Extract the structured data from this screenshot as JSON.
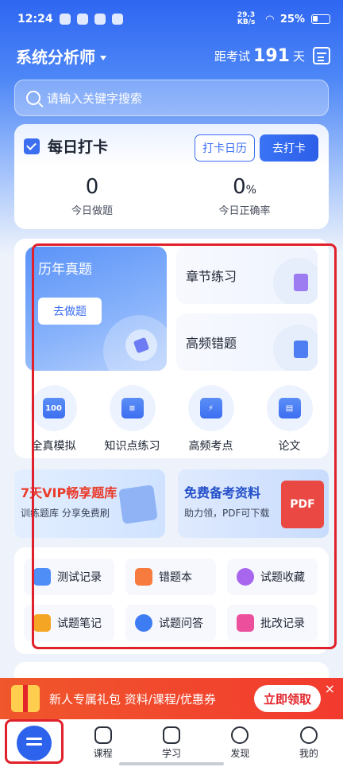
{
  "status": {
    "time": "12:24",
    "speed": "29.3 KB/s",
    "battery": "25%"
  },
  "header": {
    "title": "系统分析师",
    "countdown_prefix": "距考试",
    "countdown_days": "191",
    "countdown_suffix": "天"
  },
  "search": {
    "placeholder": "请输入关键字搜索"
  },
  "checkin": {
    "title": "每日打卡",
    "calendar_btn": "打卡日历",
    "go_btn": "去打卡",
    "stats": [
      {
        "value": "0",
        "unit": "",
        "label": "今日做题"
      },
      {
        "value": "0",
        "unit": "%",
        "label": "今日正确率"
      }
    ]
  },
  "practice": {
    "past_papers": {
      "title": "历年真题",
      "button": "去做题"
    },
    "chapter": "章节练习",
    "frequent_errors": "高频错题",
    "quick": [
      {
        "label": "全真模拟",
        "glyph": "100"
      },
      {
        "label": "知识点练习",
        "glyph": "≡"
      },
      {
        "label": "高频考点",
        "glyph": "⚡"
      },
      {
        "label": "论文",
        "glyph": "▤"
      }
    ]
  },
  "promos": [
    {
      "title": "7天VIP畅享题库",
      "subtitle": "训练题库  分享免费刷"
    },
    {
      "title": "免费备考资料",
      "subtitle": "助力领，PDF可下载",
      "badge": "PDF"
    }
  ],
  "tools": [
    {
      "label": "测试记录",
      "color": "#4f8ef6"
    },
    {
      "label": "错题本",
      "color": "#f77a3e"
    },
    {
      "label": "试题收藏",
      "color": "#a865ee"
    },
    {
      "label": "试题笔记",
      "color": "#f5a524"
    },
    {
      "label": "试题问答",
      "color": "#3e7cf3"
    },
    {
      "label": "批改记录",
      "color": "#ec4f9c"
    }
  ],
  "banner": {
    "text": "新人专属礼包  资料/课程/优惠券",
    "button": "立即领取",
    "close": "×"
  },
  "tabbar": [
    {
      "label": "",
      "icon": "home-icon"
    },
    {
      "label": "课程",
      "icon": "course-icon"
    },
    {
      "label": "学习",
      "icon": "book-icon"
    },
    {
      "label": "发现",
      "icon": "compass-icon"
    },
    {
      "label": "我的",
      "icon": "user-icon"
    }
  ],
  "colors": {
    "accent": "#3c6ef0",
    "annotation": "#e0202a",
    "banner": "#f23a2e"
  }
}
